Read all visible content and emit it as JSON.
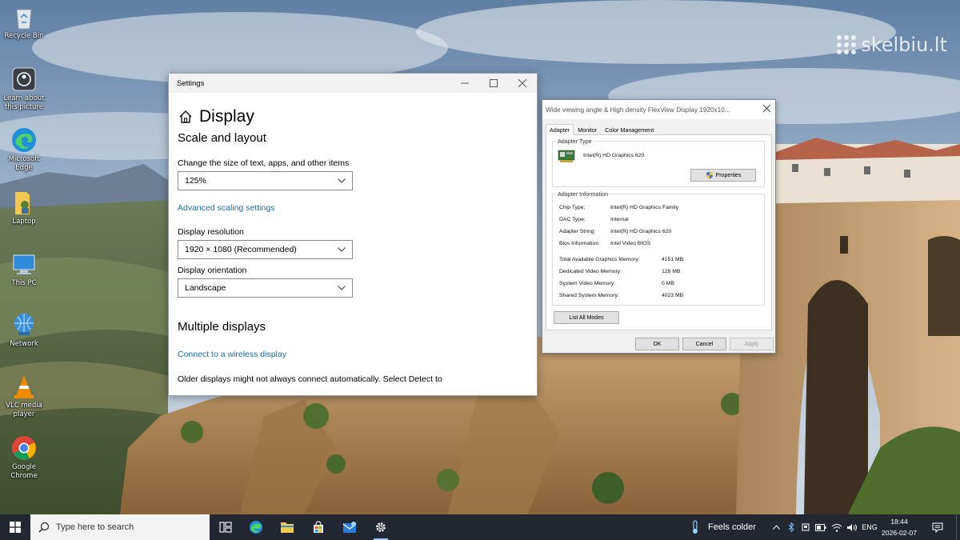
{
  "watermark": {
    "text": "skelbiu.lt"
  },
  "desktop": {
    "icons": [
      {
        "name": "recycle-bin",
        "label": "Recycle Bin"
      },
      {
        "name": "learn-about-picture",
        "label": "Learn about this picture"
      },
      {
        "name": "microsoft-edge",
        "label": "Microsoft Edge"
      },
      {
        "name": "laptop-folder",
        "label": "Laptop"
      },
      {
        "name": "this-pc",
        "label": "This PC"
      },
      {
        "name": "network",
        "label": "Network"
      },
      {
        "name": "vlc-media-player",
        "label": "VLC media player"
      },
      {
        "name": "google-chrome",
        "label": "Google Chrome"
      }
    ]
  },
  "settings": {
    "window_title": "Settings",
    "page_title": "Display",
    "scale_section": "Scale and layout",
    "scale_label": "Change the size of text, apps, and other items",
    "scale_value": "125%",
    "advanced_scaling_link": "Advanced scaling settings",
    "resolution_label": "Display resolution",
    "resolution_value": "1920 × 1080 (Recommended)",
    "orientation_label": "Display orientation",
    "orientation_value": "Landscape",
    "multiple_section": "Multiple displays",
    "wireless_link": "Connect to a wireless display",
    "older_displays_text": "Older displays might not always connect automatically. Select Detect to"
  },
  "adapter_dialog": {
    "title": "Wide viewing angle & High density FlexView Display 1920x10...",
    "tabs": [
      "Adapter",
      "Monitor",
      "Color Management"
    ],
    "active_tab": "Adapter",
    "adapter_type_legend": "Adapter Type",
    "adapter_name": "Intel(R) HD Graphics 620",
    "properties_button": "Properties",
    "adapter_info_legend": "Adapter Information",
    "info_rows": [
      {
        "label": "Chip Type:",
        "value": "Intel(R) HD Graphics Family"
      },
      {
        "label": "DAC Type:",
        "value": "Internal"
      },
      {
        "label": "Adapter String:",
        "value": "Intel(R) HD Graphics 620"
      },
      {
        "label": "Bios Information:",
        "value": "Intel Video BIOS"
      }
    ],
    "memory_rows": [
      {
        "label": "Total Available Graphics Memory:",
        "value": "4151 MB"
      },
      {
        "label": "Dedicated Video Memory:",
        "value": "128 MB"
      },
      {
        "label": "System Video Memory:",
        "value": "0 MB"
      },
      {
        "label": "Shared System Memory:",
        "value": "4023 MB"
      }
    ],
    "list_modes_button": "List All Modes",
    "ok_button": "OK",
    "cancel_button": "Cancel",
    "apply_button": "Apply"
  },
  "taskbar": {
    "search_placeholder": "Type here to search",
    "weather_text": "Feels colder",
    "language": "ENG",
    "time": "18:44",
    "date": "2026-02-07"
  }
}
